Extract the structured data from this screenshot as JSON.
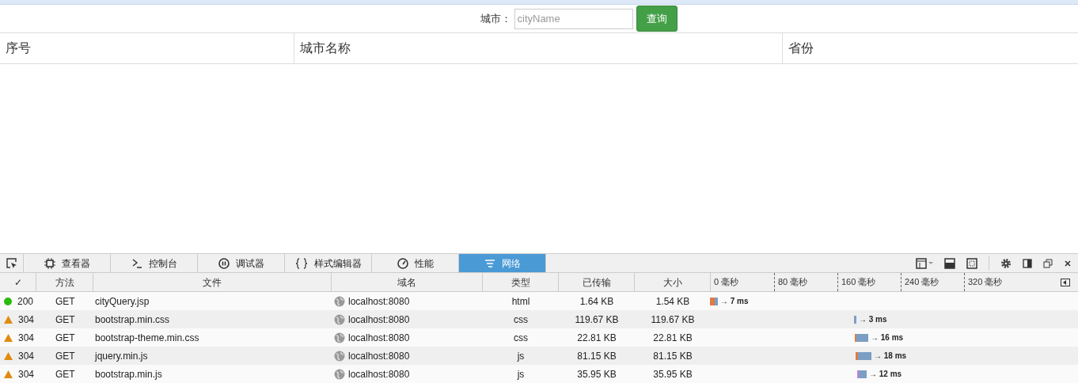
{
  "search": {
    "label": "城市：",
    "placeholder": "cityName",
    "button": "查询"
  },
  "table": {
    "columns": [
      "序号",
      "城市名称",
      "省份"
    ]
  },
  "devtools": {
    "tabs": [
      {
        "label": "查看器",
        "kind": "inspector",
        "selected": false
      },
      {
        "label": "控制台",
        "kind": "console",
        "selected": false
      },
      {
        "label": "调试器",
        "kind": "debugger",
        "selected": false
      },
      {
        "label": "样式编辑器",
        "kind": "style",
        "selected": false
      },
      {
        "label": "性能",
        "kind": "performance",
        "selected": false
      },
      {
        "label": "网络",
        "kind": "network",
        "selected": true
      }
    ],
    "network": {
      "columns": [
        "✓",
        "方法",
        "文件",
        "域名",
        "类型",
        "已传输",
        "大小"
      ],
      "timeline_ticks": [
        "0 毫秒",
        "80 毫秒",
        "160 毫秒",
        "240 毫秒",
        "320 毫秒"
      ],
      "requests": [
        {
          "status": "200",
          "kind": "ok",
          "method": "GET",
          "file": "cityQuery.jsp",
          "domain": "localhost:8080",
          "type": "html",
          "transferred": "1.64 KB",
          "size": "1.54 KB",
          "timing": "→ 7 ms"
        },
        {
          "status": "304",
          "kind": "cached",
          "method": "GET",
          "file": "bootstrap.min.css",
          "domain": "localhost:8080",
          "type": "css",
          "transferred": "119.67 KB",
          "size": "119.67 KB",
          "timing": "→ 3 ms"
        },
        {
          "status": "304",
          "kind": "cached",
          "method": "GET",
          "file": "bootstrap-theme.min.css",
          "domain": "localhost:8080",
          "type": "css",
          "transferred": "22.81 KB",
          "size": "22.81 KB",
          "timing": "→ 16 ms"
        },
        {
          "status": "304",
          "kind": "cached",
          "method": "GET",
          "file": "jquery.min.js",
          "domain": "localhost:8080",
          "type": "js",
          "transferred": "81.15 KB",
          "size": "81.15 KB",
          "timing": "→ 18 ms"
        },
        {
          "status": "304",
          "kind": "cached",
          "method": "GET",
          "file": "bootstrap.min.js",
          "domain": "localhost:8080",
          "type": "js",
          "transferred": "35.95 KB",
          "size": "35.95 KB",
          "timing": "→ 12 ms"
        }
      ]
    }
  }
}
